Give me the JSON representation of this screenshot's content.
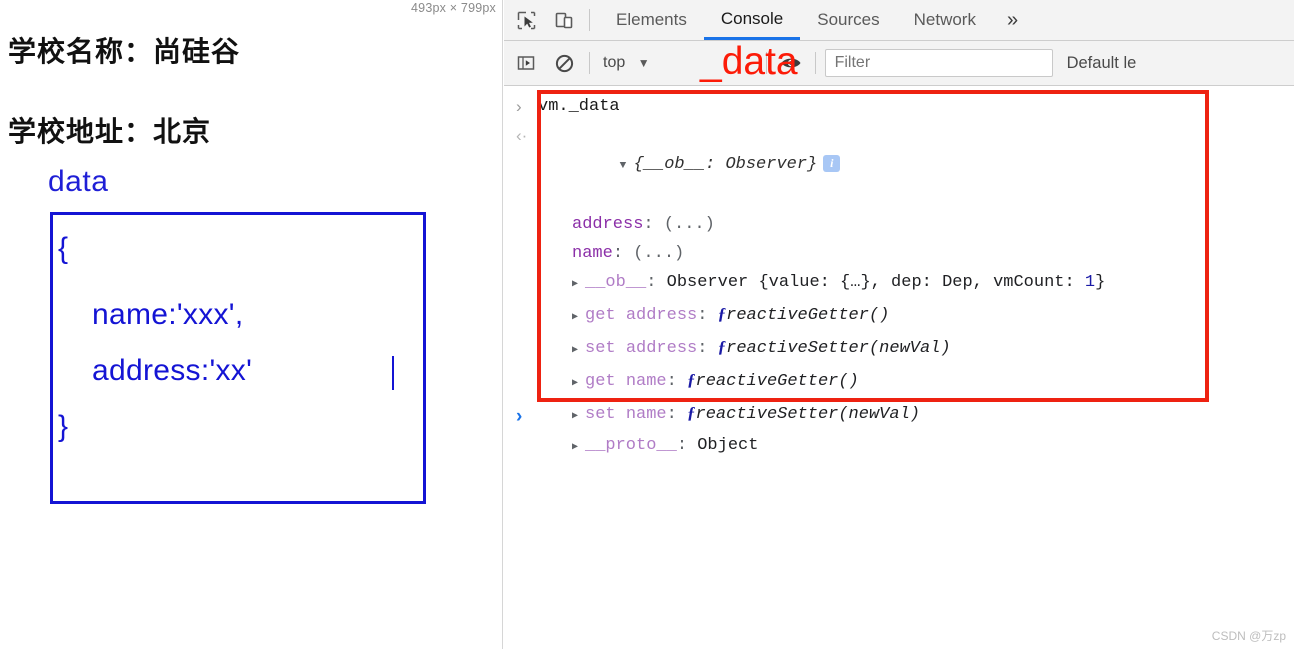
{
  "page": {
    "size_badge": "493px × 799px",
    "lines": [
      {
        "text": "学校名称：尚硅谷"
      },
      {
        "text": "学校地址：北京"
      }
    ],
    "data_caption": "data",
    "code": {
      "open_brace": "{",
      "name_prop": "name:'xxx',",
      "address_prop": "address:'xx'",
      "close_brace": "}"
    }
  },
  "devtools": {
    "tabs": [
      {
        "label": "Elements",
        "active": false
      },
      {
        "label": "Console",
        "active": true
      },
      {
        "label": "Sources",
        "active": false
      },
      {
        "label": "Network",
        "active": false
      }
    ],
    "more_tabs_glyph": "»",
    "icons": {
      "inspect": "inspect-element-icon",
      "device": "device-toolbar-icon",
      "sidebar": "console-sidebar-icon",
      "clear": "clear-console-icon",
      "eye": "live-expression-icon",
      "caret": "▼"
    },
    "filterbar": {
      "context": "top",
      "context_caret": "▼",
      "filter_placeholder": "Filter",
      "level": "Default le"
    },
    "annotation": {
      "text": "_data",
      "color": "#fc1b08"
    },
    "console": {
      "command": "vm._data",
      "prompt_in": "›",
      "prompt_out": "‹·",
      "result_head": "{__ob__: Observer}",
      "result_badge": "i",
      "properties": [
        {
          "twisty": "",
          "key": "address",
          "key_class": "k-purple",
          "value": " (...)"
        },
        {
          "twisty": "",
          "key": "name",
          "key_class": "k-purple",
          "value": " (...)"
        }
      ],
      "ob_line": {
        "twisty": "▶",
        "key": "__ob__",
        "value_prefix": "Observer {value: {…}, dep: Dep, vmCount: ",
        "value_number": "1",
        "value_suffix": "}"
      },
      "accessors": [
        {
          "twisty": "▶",
          "prefix": "get ",
          "key": "address",
          "fn_kw": "ƒ",
          "fn": "reactiveGetter()"
        },
        {
          "twisty": "▶",
          "prefix": "set ",
          "key": "address",
          "fn_kw": "ƒ",
          "fn": "reactiveSetter(newVal)"
        },
        {
          "twisty": "▶",
          "prefix": "get ",
          "key": "name",
          "fn_kw": "ƒ",
          "fn": "reactiveGetter()"
        },
        {
          "twisty": "▶",
          "prefix": "set ",
          "key": "name",
          "fn_kw": "ƒ",
          "fn": "reactiveSetter(newVal)"
        }
      ],
      "proto_line": {
        "twisty": "▶",
        "key": "__proto__",
        "value": "Object"
      },
      "live_prompt": "›"
    }
  },
  "watermark": "CSDN @万zp"
}
